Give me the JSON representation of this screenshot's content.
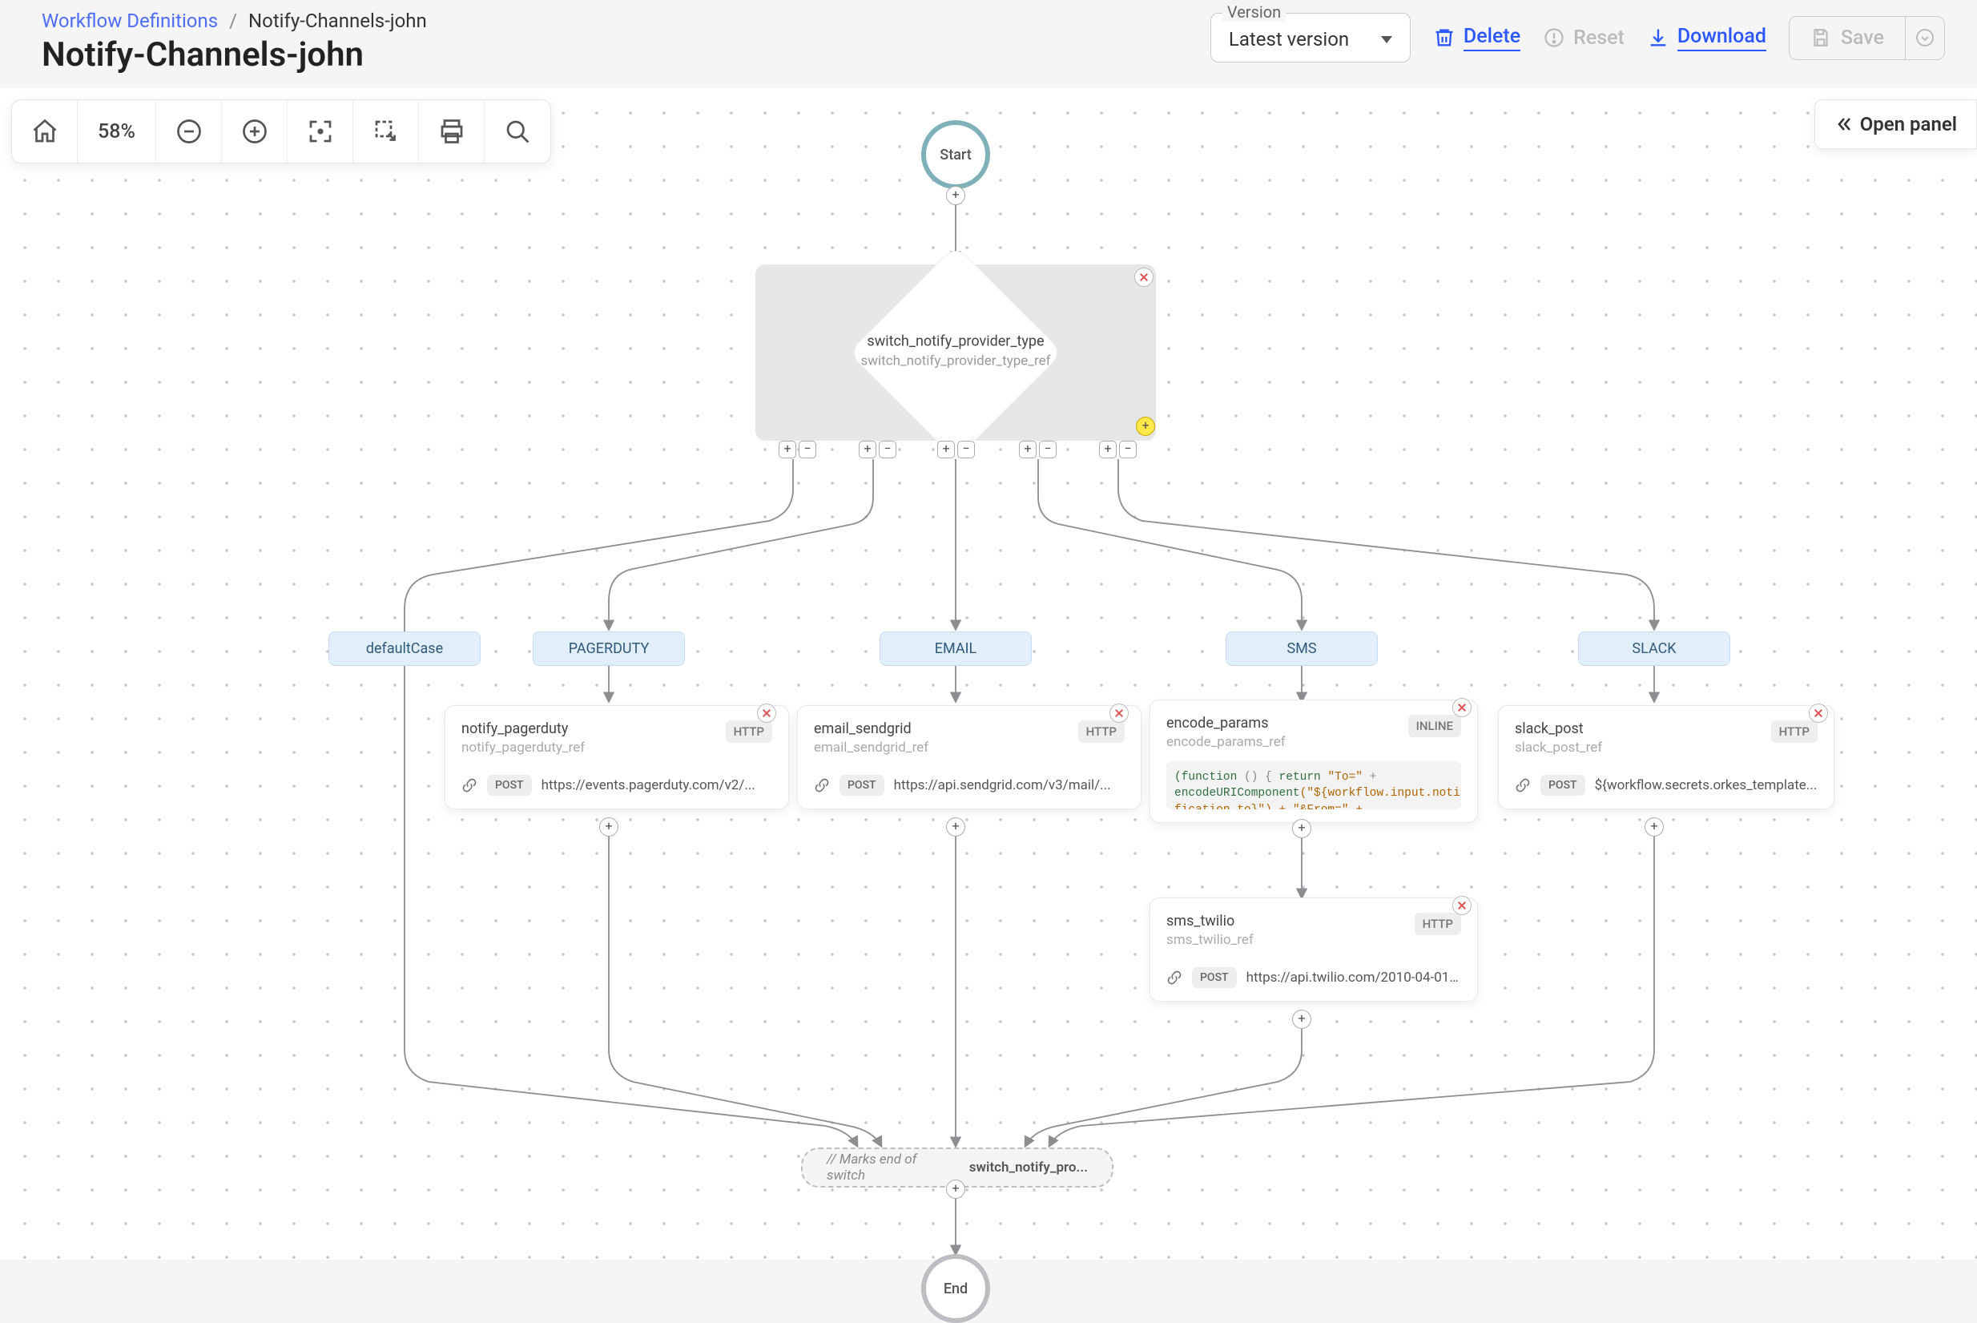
{
  "breadcrumb": {
    "root": "Workflow Definitions",
    "current": "Notify-Channels-john"
  },
  "title": "Notify-Channels-john",
  "version": {
    "legend": "Version",
    "value": "Latest version"
  },
  "header_actions": {
    "delete": "Delete",
    "reset": "Reset",
    "download": "Download",
    "save": "Save"
  },
  "toolbar": {
    "zoom": "58%"
  },
  "open_panel": "Open panel",
  "start": "Start",
  "end": "End",
  "switch": {
    "name": "switch_notify_provider_type",
    "ref": "switch_notify_provider_type_ref"
  },
  "branches": {
    "default": "defaultCase",
    "pagerduty": "PAGERDUTY",
    "email": "EMAIL",
    "sms": "SMS",
    "slack": "SLACK"
  },
  "tasks": {
    "pagerduty": {
      "name": "notify_pagerduty",
      "ref": "notify_pagerduty_ref",
      "badge": "HTTP",
      "method": "POST",
      "url": "https://events.pagerduty.com/v2/..."
    },
    "email": {
      "name": "email_sendgrid",
      "ref": "email_sendgrid_ref",
      "badge": "HTTP",
      "method": "POST",
      "url": "https://api.sendgrid.com/v3/mail/..."
    },
    "encode": {
      "name": "encode_params",
      "ref": "encode_params_ref",
      "badge": "INLINE",
      "code_plain": "(function () { return \"To=\" + encodeURIComponent(\"${workflow.input.notification_to}\") + \"&From=\" + ...",
      "code_line1_kw": "(function",
      "code_line1_rest": " () { ",
      "code_line1_kw2": "return",
      "code_line1_str": " \"To=\"",
      "code_line1_plus": " +",
      "code_line2_fn": "encodeURIComponent",
      "code_line2_arg": "(\"${workflow.input.noti",
      "code_line3": "fication_to}\") + \"&From=\" +"
    },
    "sms": {
      "name": "sms_twilio",
      "ref": "sms_twilio_ref",
      "badge": "HTTP",
      "method": "POST",
      "url": "https://api.twilio.com/2010-04-01/..."
    },
    "slack": {
      "name": "slack_post",
      "ref": "slack_post_ref",
      "badge": "HTTP",
      "method": "POST",
      "url": "${workflow.secrets.orkes_template..."
    }
  },
  "join": {
    "prefix": "// Marks end of switch",
    "name": "switch_notify_pro..."
  }
}
